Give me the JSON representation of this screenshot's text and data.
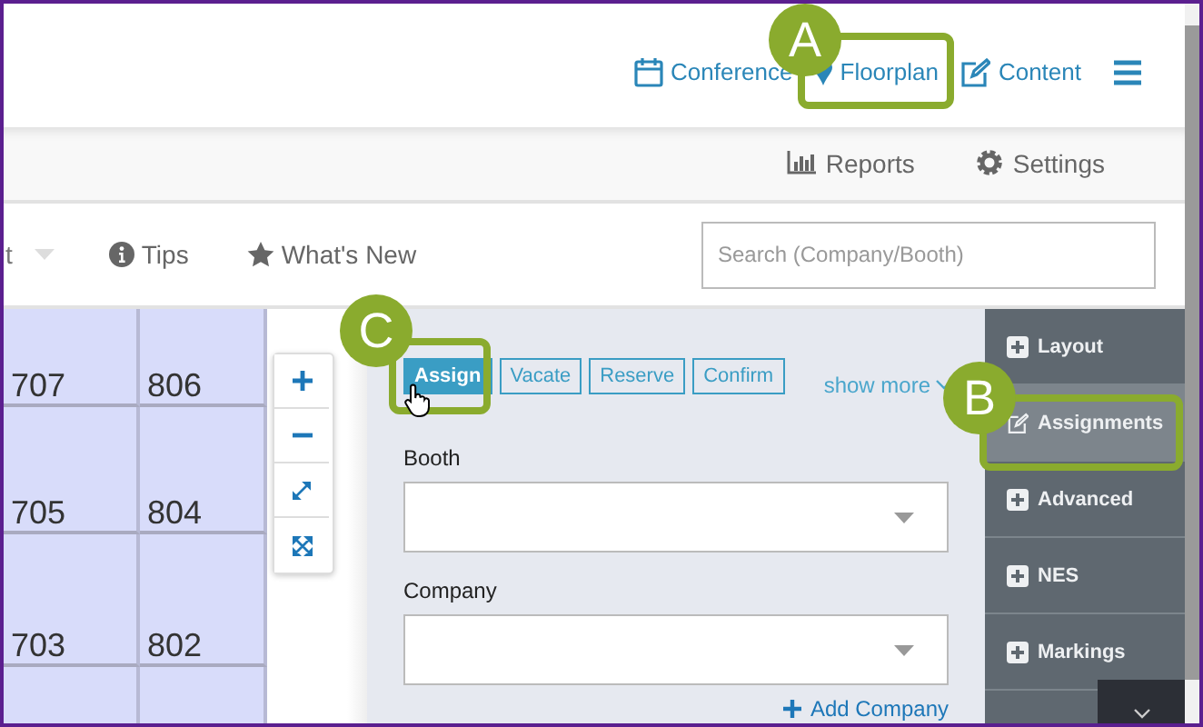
{
  "header": {
    "nav": [
      {
        "label": "Conference",
        "kind": "calendar"
      },
      {
        "label": "Floorplan",
        "kind": "pin"
      },
      {
        "label": "Content",
        "kind": "edit"
      }
    ]
  },
  "subnav": [
    {
      "label": "Reports",
      "kind": "chart"
    },
    {
      "label": "Settings",
      "kind": "gear"
    }
  ],
  "toolbar": {
    "cut_item": "t",
    "items": [
      {
        "label": "Tips",
        "kind": "info"
      },
      {
        "label": "What's New",
        "kind": "star"
      }
    ],
    "search": {
      "placeholder": "Search (Company/Booth)"
    }
  },
  "map": {
    "rows": [
      [
        "707",
        "806"
      ],
      [
        "705",
        "804"
      ],
      [
        "703",
        "802"
      ]
    ]
  },
  "zoom_controls": [
    {
      "kind": "plus"
    },
    {
      "kind": "minus"
    },
    {
      "kind": "expand"
    },
    {
      "kind": "fit"
    }
  ],
  "panel": {
    "actions": [
      {
        "label": "Assign",
        "selected": true
      },
      {
        "label": "Vacate",
        "selected": false
      },
      {
        "label": "Reserve",
        "selected": false
      },
      {
        "label": "Confirm",
        "selected": false
      }
    ],
    "show_more": "show more",
    "fields": [
      {
        "label": "Booth"
      },
      {
        "label": "Company"
      }
    ],
    "add_link": "Add Company"
  },
  "sidebar": [
    {
      "label": "Layout",
      "kind": "plus",
      "selected": false
    },
    {
      "label": "Assignments",
      "kind": "edit",
      "selected": true
    },
    {
      "label": "Advanced",
      "kind": "plus",
      "selected": false
    },
    {
      "label": "NES",
      "kind": "plus",
      "selected": false
    },
    {
      "label": "Markings",
      "kind": "plus",
      "selected": false
    }
  ],
  "callouts": [
    {
      "label": "A"
    },
    {
      "label": "B"
    },
    {
      "label": "C"
    }
  ]
}
